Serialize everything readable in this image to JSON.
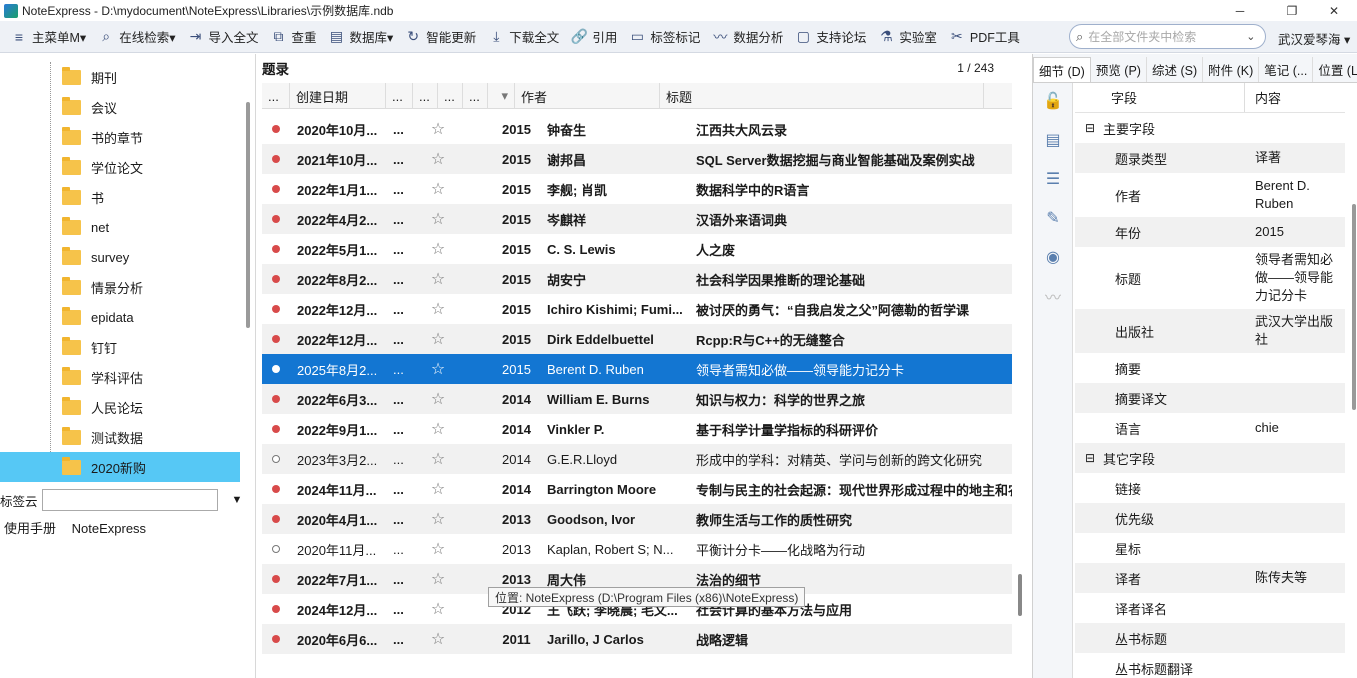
{
  "window": {
    "title": "NoteExpress - D:\\mydocument\\NoteExpress\\Libraries\\示例数据库.ndb",
    "minimize": "─",
    "maximize": "❐",
    "close": "✕"
  },
  "toolbar": {
    "items": [
      {
        "name": "main-menu",
        "icon": "menu-icon",
        "glyph": "≡",
        "label": "主菜单M▾"
      },
      {
        "name": "online-search",
        "icon": "search-icon",
        "glyph": "⌕",
        "label": "在线检索▾"
      },
      {
        "name": "import-fulltext",
        "icon": "import-icon",
        "glyph": "⇥",
        "label": "导入全文"
      },
      {
        "name": "dedupe",
        "icon": "duplicate-icon",
        "glyph": "⧉",
        "label": "查重"
      },
      {
        "name": "database",
        "icon": "database-icon",
        "glyph": "▤",
        "label": "数据库▾"
      },
      {
        "name": "smart-update",
        "icon": "refresh-icon",
        "glyph": "↻",
        "label": "智能更新"
      },
      {
        "name": "download-fulltext",
        "icon": "download-icon",
        "glyph": "⤓",
        "label": "下载全文"
      },
      {
        "name": "cite",
        "icon": "link-icon",
        "glyph": "🔗",
        "label": "引用"
      },
      {
        "name": "tag-mark",
        "icon": "tag-icon",
        "glyph": "▭",
        "label": "标签标记"
      },
      {
        "name": "data-analysis",
        "icon": "trend-icon",
        "glyph": "〰",
        "label": "数据分析"
      },
      {
        "name": "forum",
        "icon": "chat-icon",
        "glyph": "▢",
        "label": "支持论坛"
      },
      {
        "name": "lab",
        "icon": "flask-icon",
        "glyph": "⚗",
        "label": "实验室"
      },
      {
        "name": "pdf-tools",
        "icon": "tools-icon",
        "glyph": "✂",
        "label": "PDF工具"
      }
    ],
    "search_placeholder": "在全部文件夹中检索",
    "user": "武汉爱琴海 ▾"
  },
  "tree": {
    "items": [
      "期刊",
      "会议",
      "书的章节",
      "学位论文",
      "书",
      "net",
      "survey",
      "情景分析",
      "epidata",
      "钉钉",
      "学科评估",
      "人民论坛",
      "测试数据",
      "2020新购"
    ],
    "selected_index": 13
  },
  "tagcloud": {
    "label": "标签云",
    "links": [
      "使用手册",
      "NoteExpress"
    ]
  },
  "list": {
    "title": "题录",
    "count": "1 / 243",
    "columns": [
      "...",
      "创建日期",
      "...",
      "...",
      "...",
      "...",
      "▾",
      "作者",
      "标题"
    ],
    "rows": [
      {
        "read": false,
        "date": "2020年10月...",
        "a": "...",
        "year": "2015",
        "author": "钟奋生",
        "title": "江西共大风云录"
      },
      {
        "read": false,
        "date": "2021年10月...",
        "a": "...",
        "year": "2015",
        "author": "谢邦昌",
        "title": "SQL Server数据挖掘与商业智能基础及案例实战"
      },
      {
        "read": false,
        "date": "2022年1月1...",
        "a": "...",
        "year": "2015",
        "author": "李舰; 肖凯",
        "title": "数据科学中的R语言"
      },
      {
        "read": false,
        "date": "2022年4月2...",
        "a": "...",
        "year": "2015",
        "author": "岑麒祥",
        "title": "汉语外来语词典"
      },
      {
        "read": false,
        "date": "2022年5月1...",
        "a": "...",
        "year": "2015",
        "author": "C. S. Lewis",
        "title": "人之废"
      },
      {
        "read": false,
        "date": "2022年8月2...",
        "a": "...",
        "year": "2015",
        "author": "胡安宁",
        "title": "社会科学因果推断的理论基础"
      },
      {
        "read": false,
        "date": "2022年12月...",
        "a": "...",
        "year": "2015",
        "author": "Ichiro Kishimi; Fumi...",
        "title": "被讨厌的勇气：“自我启发之父”阿德勒的哲学课"
      },
      {
        "read": false,
        "date": "2022年12月...",
        "a": "...",
        "year": "2015",
        "author": "Dirk Eddelbuettel",
        "title": "Rcpp:R与C++的无缝整合"
      },
      {
        "read": false,
        "date": "2025年8月2...",
        "a": "...",
        "year": "2015",
        "author": "Berent D. Ruben",
        "title": "领导者需知必做——领导能力记分卡",
        "selected": true
      },
      {
        "read": false,
        "date": "2022年6月3...",
        "a": "...",
        "year": "2014",
        "author": "William E. Burns",
        "title": "知识与权力：科学的世界之旅"
      },
      {
        "read": false,
        "date": "2022年9月1...",
        "a": "...",
        "year": "2014",
        "author": "Vinkler P.",
        "title": "基于科学计量学指标的科研评价"
      },
      {
        "read": true,
        "date": "2023年3月2...",
        "a": "...",
        "year": "2014",
        "author": "G.E.R.Lloyd",
        "title": "形成中的学科：对精英、学问与创新的跨文化研究"
      },
      {
        "read": false,
        "date": "2024年11月...",
        "a": "...",
        "year": "2014",
        "author": "Barrington Moore",
        "title": "专制与民主的社会起源：现代世界形成过程中的地主和农"
      },
      {
        "read": false,
        "date": "2020年4月1...",
        "a": "...",
        "year": "2013",
        "author": "Goodson, Ivor",
        "title": "教师生活与工作的质性研究"
      },
      {
        "read": true,
        "date": "2020年11月...",
        "a": "...",
        "year": "2013",
        "author": "Kaplan, Robert S; N...",
        "title": "平衡计分卡——化战略为行动"
      },
      {
        "read": false,
        "date": "2022年7月1...",
        "a": "...",
        "year": "2013",
        "author": "周大伟",
        "title": "法治的细节"
      },
      {
        "read": false,
        "date": "2024年12月...",
        "a": "...",
        "year": "2012",
        "author": "王飞跃; 李晓晨; 毛文...",
        "title": "社会计算的基本方法与应用"
      },
      {
        "read": false,
        "date": "2020年6月6...",
        "a": "...",
        "year": "2011",
        "author": "Jarillo, J Carlos",
        "title": "战略逻辑"
      }
    ],
    "tooltip": "位置: NoteExpress (D:\\Program Files (x86)\\NoteExpress)"
  },
  "detail": {
    "tabs": [
      "细节 (D)",
      "预览 (P)",
      "综述 (S)",
      "附件 (K)",
      "笔记 (...",
      "位置 (L)"
    ],
    "active_tab": 0,
    "side_icons": [
      "lock-icon",
      "document-icon",
      "notes-icon",
      "edit-icon",
      "eye-icon",
      "chart-icon"
    ],
    "head": {
      "field": "字段",
      "content": "内容"
    },
    "groups": [
      {
        "title": "主要字段",
        "toggle": "⊟",
        "rows": [
          {
            "k": "题录类型",
            "v": "译著",
            "h": 30
          },
          {
            "k": "作者",
            "v": "Berent D. Ruben",
            "h": 44
          },
          {
            "k": "年份",
            "v": "2015",
            "h": 30
          },
          {
            "k": "标题",
            "v": "领导者需知必做——领导能力记分卡",
            "h": 62
          },
          {
            "k": "出版社",
            "v": "武汉大学出版社",
            "h": 44
          },
          {
            "k": "摘要",
            "v": "",
            "h": 30
          },
          {
            "k": "摘要译文",
            "v": "",
            "h": 30
          },
          {
            "k": "语言",
            "v": "chie",
            "h": 30
          }
        ]
      },
      {
        "title": "其它字段",
        "toggle": "⊟",
        "rows": [
          {
            "k": "链接",
            "v": "",
            "h": 30
          },
          {
            "k": "优先级",
            "v": "",
            "h": 30
          },
          {
            "k": "星标",
            "v": "",
            "h": 30
          },
          {
            "k": "译者",
            "v": "陈传夫等",
            "h": 30
          },
          {
            "k": "译者译名",
            "v": "",
            "h": 30
          },
          {
            "k": "丛书标题",
            "v": "",
            "h": 30
          },
          {
            "k": "丛书标题翻译",
            "v": "",
            "h": 30
          }
        ]
      }
    ]
  }
}
